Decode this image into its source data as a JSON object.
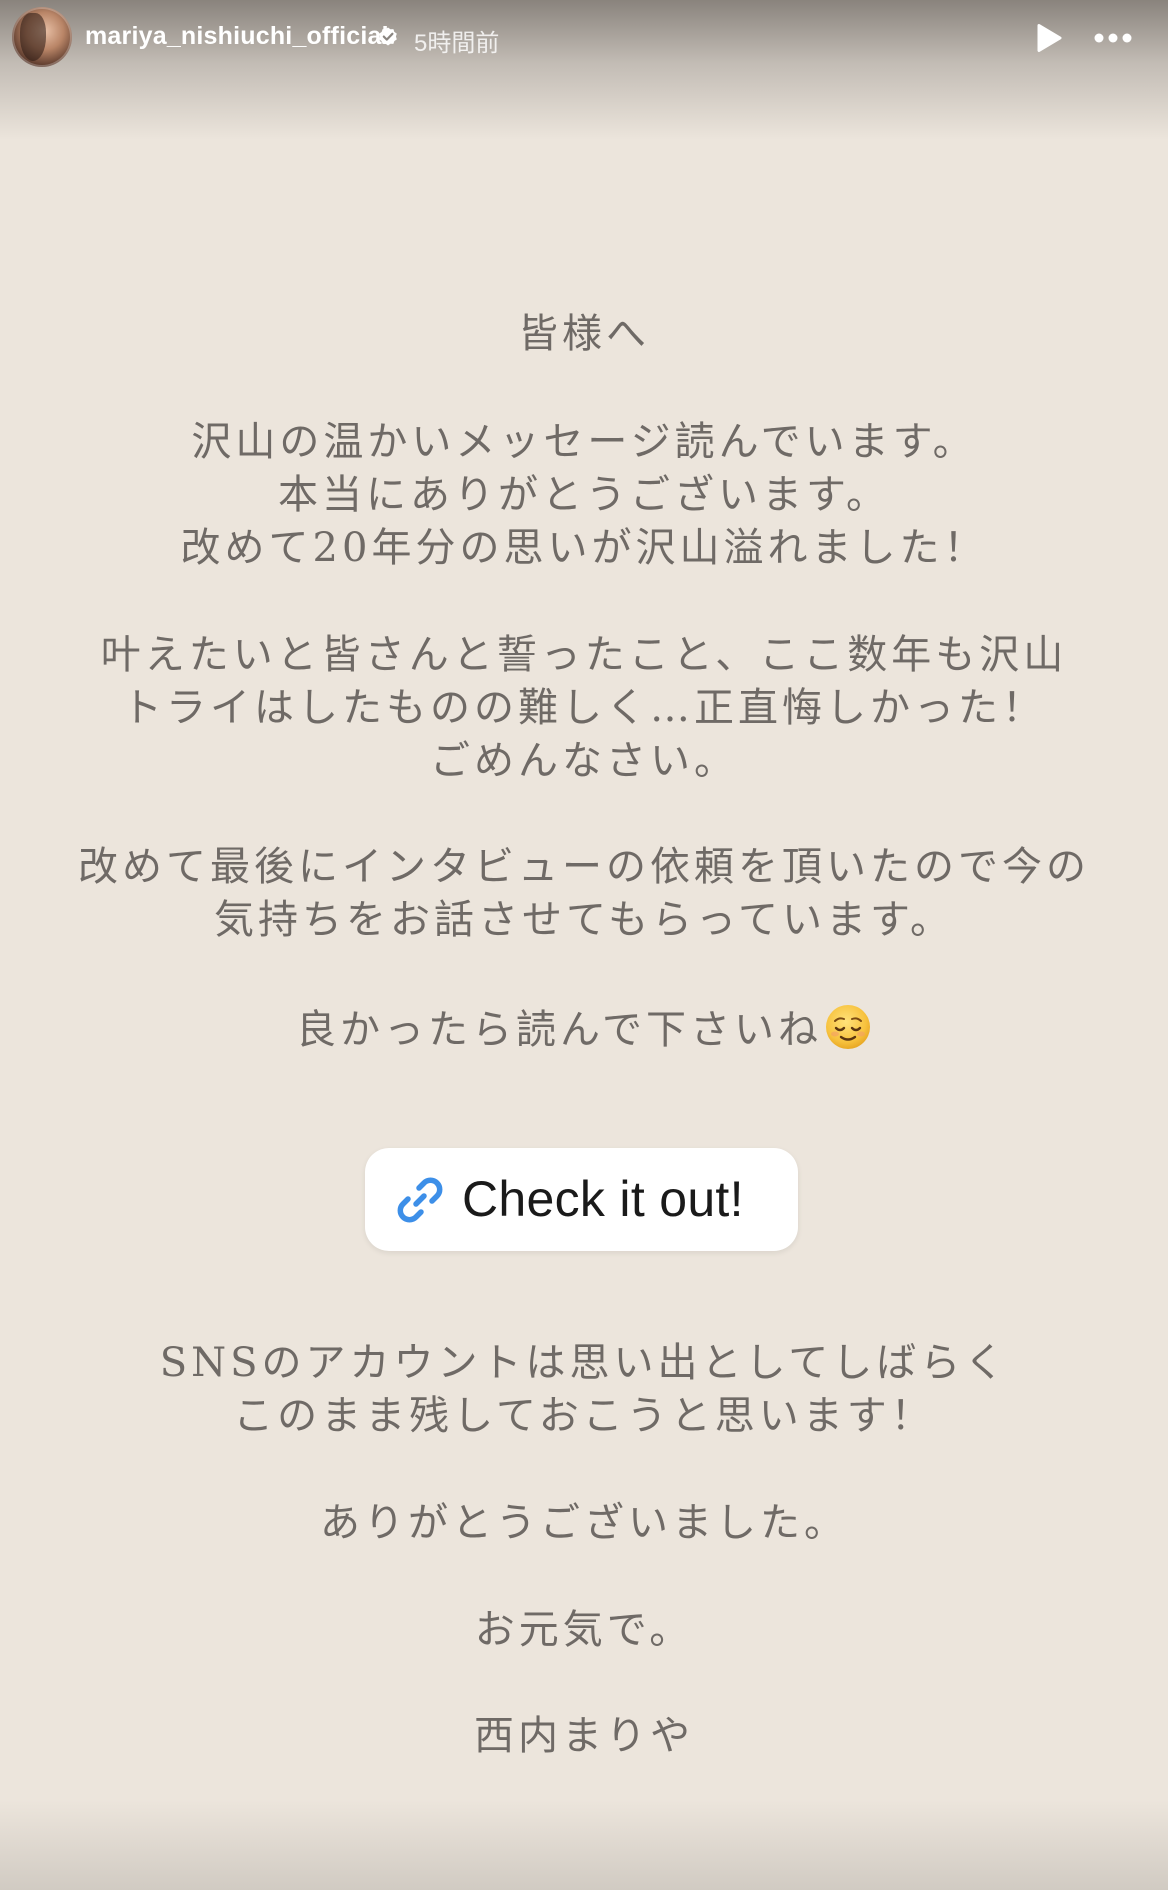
{
  "header": {
    "username": "mariya_nishiuchi_official",
    "timestamp": "5時間前",
    "verified": true
  },
  "message": {
    "greeting": "皆様へ",
    "paragraph1": [
      "沢山の温かいメッセージ読んでいます。",
      "本当にありがとうございます。",
      "改めて20年分の思いが沢山溢れました！"
    ],
    "paragraph2": [
      "叶えたいと皆さんと誓ったこと、ここ数年も沢山",
      "トライはしたものの難しく…正直悔しかった！",
      "ごめんなさい。"
    ],
    "paragraph3": [
      "改めて最後にインタビューの依頼を頂いたので今の",
      "気持ちをお話させてもらっています。"
    ],
    "closing_line": "良かったら読んで下さいね",
    "closing_emoji": "relieved-face-icon",
    "paragraph4": [
      "SNSのアカウントは思い出としてしばらく",
      "このまま残しておこうと思います！"
    ],
    "thanks": "ありがとうございました。",
    "farewell": "お元気で。",
    "signature": "西内まりや"
  },
  "link_sticker": {
    "label": "Check it out!",
    "icon": "link-icon",
    "icon_color": "#3d8fe8"
  },
  "colors": {
    "background": "#ece5dc",
    "text": "#6f6a66"
  }
}
